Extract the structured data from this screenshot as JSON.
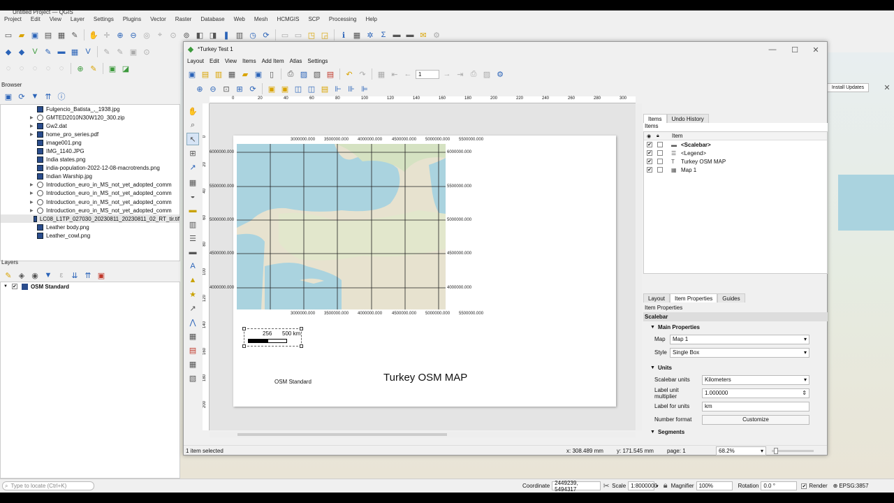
{
  "app": {
    "title": "Untitled Project — QGIS"
  },
  "main_menu": [
    "Project",
    "Edit",
    "View",
    "Layer",
    "Settings",
    "Plugins",
    "Vector",
    "Raster",
    "Database",
    "Web",
    "Mesh",
    "HCMGIS",
    "SCP",
    "Processing",
    "Help"
  ],
  "browser": {
    "title": "Browser",
    "items": [
      {
        "label": "Fulgencio_Batista_,_1938.jpg",
        "arrow": false,
        "zip": false
      },
      {
        "label": "GMTED2010N30W120_300.zip",
        "arrow": true,
        "zip": true
      },
      {
        "label": "Gw2.dat",
        "arrow": true,
        "zip": false
      },
      {
        "label": "home_pro_series.pdf",
        "arrow": true,
        "zip": false
      },
      {
        "label": "image001.png",
        "arrow": false,
        "zip": false
      },
      {
        "label": "IMG_1140.JPG",
        "arrow": false,
        "zip": false
      },
      {
        "label": "India states.png",
        "arrow": false,
        "zip": false
      },
      {
        "label": "india-population-2022-12-08-macrotrends.png",
        "arrow": false,
        "zip": false
      },
      {
        "label": "Indian Warship.jpg",
        "arrow": false,
        "zip": false
      },
      {
        "label": "Introduction_euro_in_MS_not_yet_adopted_comm",
        "arrow": true,
        "zip": true
      },
      {
        "label": "Introduction_euro_in_MS_not_yet_adopted_comm",
        "arrow": true,
        "zip": true
      },
      {
        "label": "Introduction_euro_in_MS_not_yet_adopted_comm",
        "arrow": true,
        "zip": true
      },
      {
        "label": "Introduction_euro_in_MS_not_yet_adopted_comm",
        "arrow": true,
        "zip": true
      },
      {
        "label": "LC08_L1TP_027030_20230811_20230811_02_RT_tir.tif",
        "arrow": false,
        "zip": false
      },
      {
        "label": "Leather body.png",
        "arrow": false,
        "zip": false
      },
      {
        "label": "Leather_cowl.png",
        "arrow": false,
        "zip": false
      }
    ]
  },
  "layers": {
    "title": "Layers",
    "items": [
      {
        "label": "OSM Standard"
      }
    ]
  },
  "layout_window": {
    "title": "*Turkey Test 1",
    "menu": [
      "Layout",
      "Edit",
      "View",
      "Items",
      "Add Item",
      "Atlas",
      "Settings"
    ],
    "page_number": "1",
    "ruler_top": [
      "0",
      "20",
      "40",
      "60",
      "80",
      "100",
      "120",
      "140",
      "160",
      "180",
      "200",
      "220",
      "240",
      "260",
      "280",
      "300"
    ],
    "ruler_left": [
      "0",
      "20",
      "40",
      "60",
      "80",
      "100",
      "120",
      "140",
      "160",
      "180",
      "200"
    ],
    "grid_top": [
      "3000000.000",
      "3500000.000",
      "4000000.000",
      "4500000.000",
      "5000000.000",
      "5500000.000"
    ],
    "grid_right": [
      "6000000.000",
      "5500000.000",
      "5000000.000",
      "4500000.000",
      "4000000.000"
    ],
    "grid_left": [
      "6000000.000",
      "5500000.000",
      "5000000.000",
      "4500000.000",
      "4000000.000"
    ],
    "scalebar": {
      "left": "",
      "mid": "256",
      "right": "500 km"
    },
    "legend_text": "OSM Standard",
    "map_title": "Turkey OSM MAP",
    "status": {
      "selected": "1 item selected",
      "x": "x: 308.489 mm",
      "y": "y: 171.545 mm",
      "page": "page: 1",
      "zoom": "68.2%"
    }
  },
  "items_panel": {
    "tabs": [
      "Items",
      "Undo History"
    ],
    "title": "Items",
    "column": "Item",
    "rows": [
      {
        "label": "<Scalebar>",
        "checked": true,
        "bold": true
      },
      {
        "label": "<Legend>",
        "checked": true,
        "bold": false
      },
      {
        "label": "Turkey OSM MAP",
        "checked": true,
        "bold": false
      },
      {
        "label": "Map 1",
        "checked": true,
        "bold": false
      }
    ]
  },
  "props_panel": {
    "tabs": [
      "Layout",
      "Item Properties",
      "Guides"
    ],
    "title": "Item Properties",
    "header": "Scalebar",
    "main_section": "Main Properties",
    "map_label": "Map",
    "map_value": "Map 1",
    "style_label": "Style",
    "style_value": "Single Box",
    "units_section": "Units",
    "units_label": "Scalebar units",
    "units_value": "Kilometers",
    "mult_label": "Label unit multiplier",
    "mult_value": "1.000000",
    "lfu_label": "Label for units",
    "lfu_value": "km",
    "nf_label": "Number format",
    "nf_button": "Customize",
    "segments_section": "Segments"
  },
  "statusbar": {
    "locate_placeholder": "Type to locate (Ctrl+K)",
    "coord_label": "Coordinate",
    "coord_value": "2449239, 5494317",
    "scale_label": "Scale",
    "scale_value": "1:8000000",
    "magnifier_label": "Magnifier",
    "magnifier_value": "100%",
    "rotation_label": "Rotation",
    "rotation_value": "0.0 °",
    "render_label": "Render",
    "crs": "EPSG:3857"
  },
  "install_updates": "Install Updates"
}
